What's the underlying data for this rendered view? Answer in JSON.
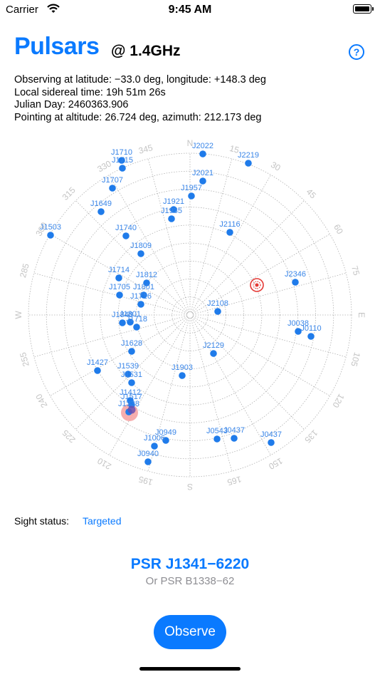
{
  "status_bar": {
    "carrier": "Carrier",
    "time": "9:45 AM"
  },
  "header": {
    "title": "Pulsars",
    "subtitle": "@ 1.4GHz",
    "help_label": "?"
  },
  "info": {
    "lines": [
      "Observing at latitude: −33.0 deg,   longitude: +148.3 deg",
      "Local sidereal time: 19h 51m 26s",
      "Julian Day: 2460363.906",
      "Pointing at altitude: 26.724 deg,   azimuth: 212.173 deg"
    ]
  },
  "sky": {
    "directions": {
      "north": "N",
      "east": "E",
      "south": "S",
      "west": "W"
    },
    "azimuth_labels": [
      "15",
      "30",
      "45",
      "60",
      "75",
      "105",
      "120",
      "135",
      "150",
      "165",
      "195",
      "210",
      "225",
      "240",
      "255",
      "285",
      "300",
      "315",
      "330",
      "345"
    ],
    "pulsars": [
      "J2022",
      "J2219",
      "J1710",
      "J1715",
      "J2021",
      "J1957",
      "J1707",
      "J1921",
      "J1649",
      "J1935",
      "J2116",
      "J1503",
      "J1740",
      "J1809",
      "J2346",
      "J1714",
      "J1812",
      "J1705",
      "J1801",
      "J1716",
      "J2108",
      "J1848",
      "J1801",
      "J1718",
      "J0038",
      "J0110",
      "J1628",
      "J2129",
      "J1427",
      "J1539",
      "J1531",
      "J1903",
      "J1412",
      "J1517",
      "J1338",
      "J0949",
      "J0543",
      "J0437",
      "J0437",
      "J1006",
      "J0940"
    ],
    "colors": {
      "pulsar": "#1f7bea",
      "label": "#3a86e8",
      "grid": "#b0b0b0",
      "target": "#e53935",
      "selected": "#f4a0a0"
    }
  },
  "sight": {
    "label": "Sight status:",
    "value": "Targeted"
  },
  "selected": {
    "name": "PSR J1341−6220",
    "alt_name": "Or PSR B1338−62"
  },
  "observe_label": "Observe"
}
